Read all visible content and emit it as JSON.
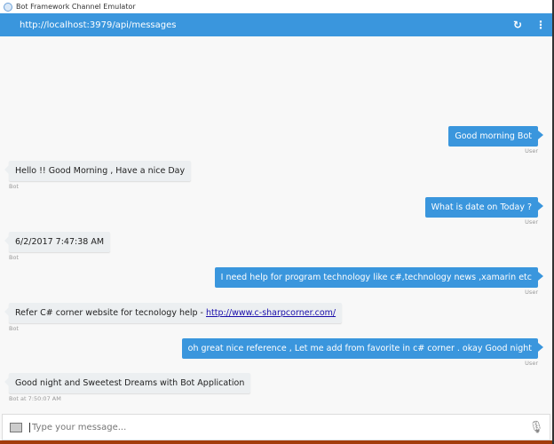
{
  "window": {
    "title": "Bot Framework Channel Emulator"
  },
  "header": {
    "url": "http://localhost:3979/api/messages",
    "refresh_icon": "↻",
    "menu_icon": "⋮"
  },
  "messages": [
    {
      "from": "user",
      "text": "Good morning Bot",
      "meta": "User"
    },
    {
      "from": "bot",
      "text": "Hello !! Good Morning , Have a nice Day",
      "meta": "Bot"
    },
    {
      "from": "user",
      "text": "What is date on Today ?",
      "meta": "User"
    },
    {
      "from": "bot",
      "text": "6/2/2017 7:47:38 AM",
      "meta": "Bot"
    },
    {
      "from": "user",
      "text": "I need help for program technology like c#,technology news ,xamarin etc",
      "meta": "User"
    },
    {
      "from": "bot",
      "text": "Refer C# corner website for tecnology help - ",
      "link": "http://www.c-sharpcorner.com/",
      "meta": "Bot"
    },
    {
      "from": "user",
      "text": "oh great nice reference , Let me add from favorite in c# corner . okay Good night",
      "meta": "User"
    },
    {
      "from": "bot",
      "text": "Good night and Sweetest Dreams with Bot Application",
      "meta": "Bot at 7:50:07 AM"
    }
  ],
  "input": {
    "placeholder": "Type your message..."
  }
}
